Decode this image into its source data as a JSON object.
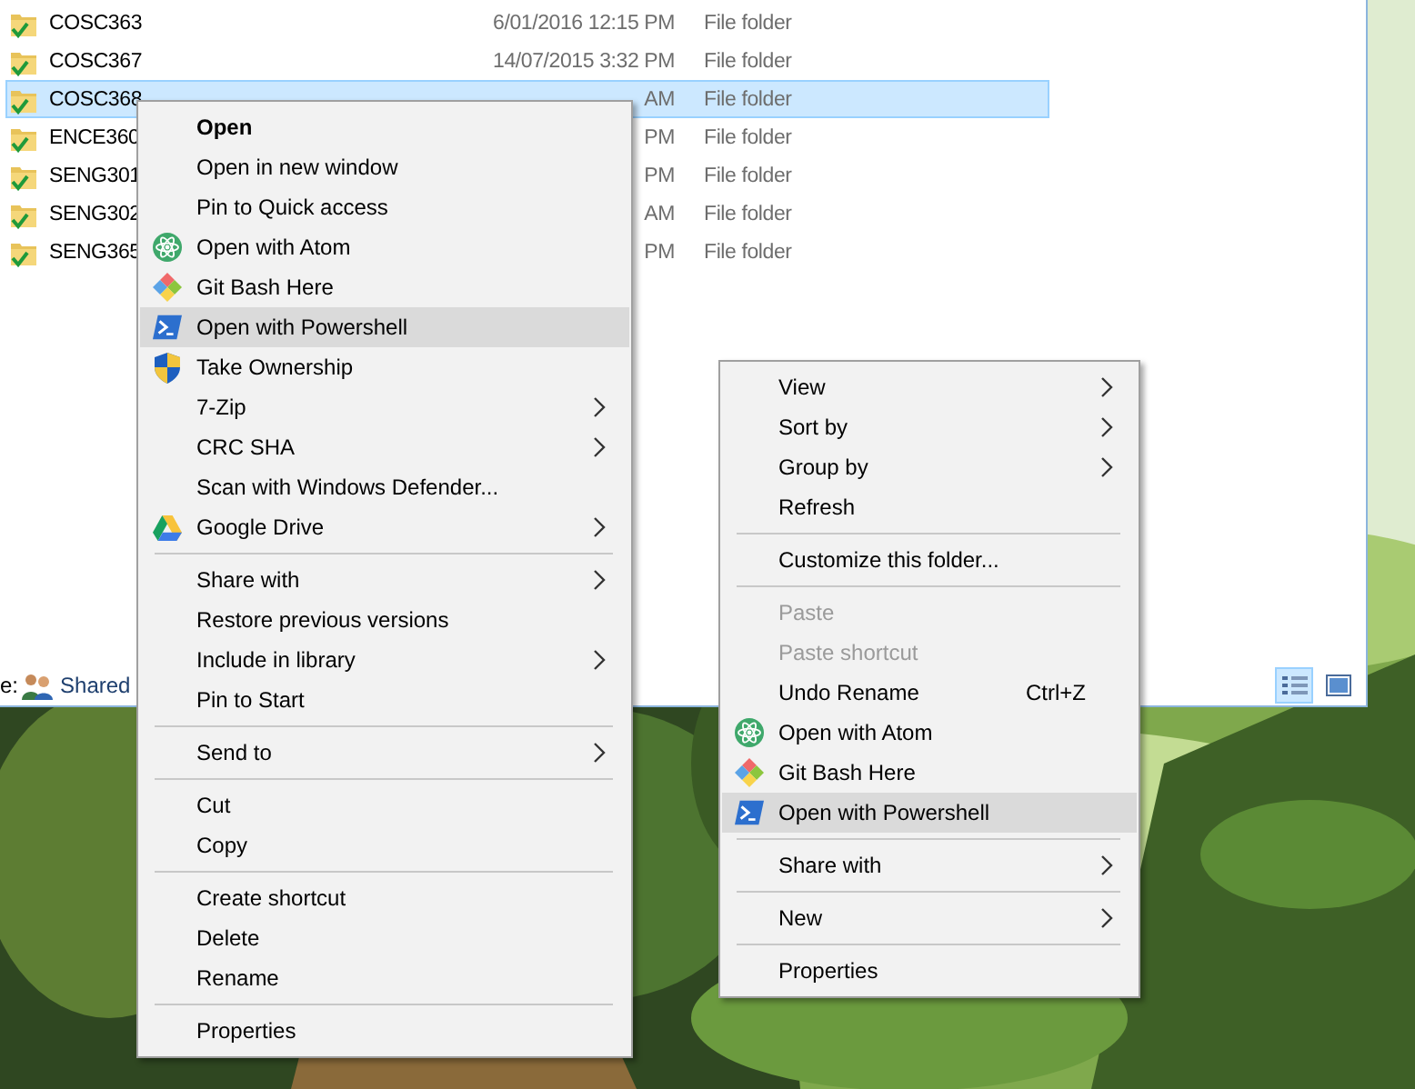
{
  "explorer": {
    "rows": [
      {
        "name": "COSC363",
        "date": "6/01/2016 12:15 PM",
        "type": "File folder",
        "selected": false
      },
      {
        "name": "COSC367",
        "date": "14/07/2015 3:32 PM",
        "type": "File folder",
        "selected": false
      },
      {
        "name": "COSC368",
        "date": "AM",
        "type": "File folder",
        "selected": true
      },
      {
        "name": "ENCE360",
        "date": "PM",
        "type": "File folder",
        "selected": false
      },
      {
        "name": "SENG301",
        "date": "PM",
        "type": "File folder",
        "selected": false
      },
      {
        "name": "SENG302",
        "date": "AM",
        "type": "File folder",
        "selected": false
      },
      {
        "name": "SENG365",
        "date": "PM",
        "type": "File folder",
        "selected": false
      }
    ],
    "status_bar": {
      "label": "e:",
      "state": "Shared"
    },
    "view_buttons": [
      {
        "selected": true
      },
      {
        "selected": false
      }
    ]
  },
  "folder_menu": {
    "items": [
      {
        "kind": "item",
        "label": "Open",
        "default": true,
        "selected": false,
        "submenu": false
      },
      {
        "kind": "item",
        "label": "Open in new window",
        "default": false,
        "selected": false,
        "submenu": false
      },
      {
        "kind": "item",
        "label": "Pin to Quick access",
        "default": false,
        "selected": false,
        "submenu": false
      },
      {
        "kind": "item",
        "label": "Open with Atom",
        "default": false,
        "selected": false,
        "submenu": false
      },
      {
        "kind": "item",
        "label": "Git Bash Here",
        "default": false,
        "selected": false,
        "submenu": false
      },
      {
        "kind": "item",
        "label": "Open with Powershell",
        "default": false,
        "selected": true,
        "submenu": false
      },
      {
        "kind": "item",
        "label": "Take Ownership",
        "default": false,
        "selected": false,
        "submenu": false
      },
      {
        "kind": "item",
        "label": "7-Zip",
        "default": false,
        "selected": false,
        "submenu": true
      },
      {
        "kind": "item",
        "label": "CRC SHA",
        "default": false,
        "selected": false,
        "submenu": true
      },
      {
        "kind": "item",
        "label": "Scan with Windows Defender...",
        "default": false,
        "selected": false,
        "submenu": false
      },
      {
        "kind": "item",
        "label": "Google Drive",
        "default": false,
        "selected": false,
        "submenu": true
      },
      {
        "kind": "separator"
      },
      {
        "kind": "item",
        "label": "Share with",
        "default": false,
        "selected": false,
        "submenu": true
      },
      {
        "kind": "item",
        "label": "Restore previous versions",
        "default": false,
        "selected": false,
        "submenu": false
      },
      {
        "kind": "item",
        "label": "Include in library",
        "default": false,
        "selected": false,
        "submenu": true
      },
      {
        "kind": "item",
        "label": "Pin to Start",
        "default": false,
        "selected": false,
        "submenu": false
      },
      {
        "kind": "separator"
      },
      {
        "kind": "item",
        "label": "Send to",
        "default": false,
        "selected": false,
        "submenu": true
      },
      {
        "kind": "separator"
      },
      {
        "kind": "item",
        "label": "Cut",
        "default": false,
        "selected": false,
        "submenu": false
      },
      {
        "kind": "item",
        "label": "Copy",
        "default": false,
        "selected": false,
        "submenu": false
      },
      {
        "kind": "separator"
      },
      {
        "kind": "item",
        "label": "Create shortcut",
        "default": false,
        "selected": false,
        "submenu": false
      },
      {
        "kind": "item",
        "label": "Delete",
        "default": false,
        "selected": false,
        "submenu": false
      },
      {
        "kind": "item",
        "label": "Rename",
        "default": false,
        "selected": false,
        "submenu": false
      },
      {
        "kind": "separator"
      },
      {
        "kind": "item",
        "label": "Properties",
        "default": false,
        "selected": false,
        "submenu": false
      }
    ]
  },
  "background_menu": {
    "items": [
      {
        "kind": "item",
        "label": "View",
        "disabled": false,
        "selected": false,
        "submenu": true
      },
      {
        "kind": "item",
        "label": "Sort by",
        "disabled": false,
        "selected": false,
        "submenu": true
      },
      {
        "kind": "item",
        "label": "Group by",
        "disabled": false,
        "selected": false,
        "submenu": true
      },
      {
        "kind": "item",
        "label": "Refresh",
        "disabled": false,
        "selected": false,
        "submenu": false
      },
      {
        "kind": "separator"
      },
      {
        "kind": "item",
        "label": "Customize this folder...",
        "disabled": false,
        "selected": false,
        "submenu": false
      },
      {
        "kind": "separator"
      },
      {
        "kind": "item",
        "label": "Paste",
        "disabled": true,
        "selected": false,
        "submenu": false
      },
      {
        "kind": "item",
        "label": "Paste shortcut",
        "disabled": true,
        "selected": false,
        "submenu": false
      },
      {
        "kind": "item",
        "label": "Undo Rename",
        "shortcut": "Ctrl+Z",
        "disabled": false,
        "selected": false,
        "submenu": false
      },
      {
        "kind": "item",
        "label": "Open with Atom",
        "disabled": false,
        "selected": false,
        "submenu": false
      },
      {
        "kind": "item",
        "label": "Git Bash Here",
        "disabled": false,
        "selected": false,
        "submenu": false
      },
      {
        "kind": "item",
        "label": "Open with Powershell",
        "disabled": false,
        "selected": true,
        "submenu": false
      },
      {
        "kind": "separator"
      },
      {
        "kind": "item",
        "label": "Share with",
        "disabled": false,
        "selected": false,
        "submenu": true
      },
      {
        "kind": "separator"
      },
      {
        "kind": "item",
        "label": "New",
        "disabled": false,
        "selected": false,
        "submenu": true
      },
      {
        "kind": "separator"
      },
      {
        "kind": "item",
        "label": "Properties",
        "disabled": false,
        "selected": false,
        "submenu": false
      }
    ]
  }
}
